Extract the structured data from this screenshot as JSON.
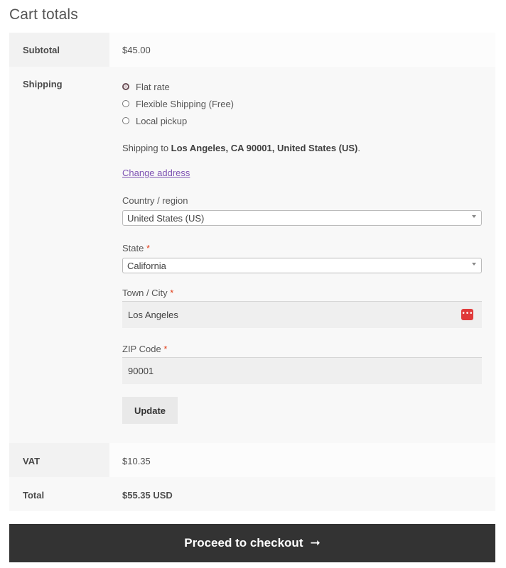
{
  "heading": "Cart totals",
  "subtotal": {
    "label": "Subtotal",
    "value": "$45.00"
  },
  "shipping": {
    "label": "Shipping",
    "methods": [
      {
        "label": "Flat rate",
        "selected": true
      },
      {
        "label": "Flexible Shipping (Free)",
        "selected": false
      },
      {
        "label": "Local pickup",
        "selected": false
      }
    ],
    "destination_prefix": "Shipping to ",
    "destination": "Los Angeles, CA 90001, United States (US)",
    "destination_suffix": ".",
    "change_address": "Change address",
    "country_label": "Country / region",
    "country_value": "United States (US)",
    "state_label": "State",
    "state_value": "California",
    "city_label": "Town / City",
    "city_value": "Los Angeles",
    "zip_label": "ZIP Code",
    "zip_value": "90001",
    "required_mark": "*",
    "update_label": "Update"
  },
  "vat": {
    "label": "VAT",
    "value": "$10.35"
  },
  "total": {
    "label": "Total",
    "value": "$55.35 USD"
  },
  "checkout": {
    "label": "Proceed to checkout",
    "arrow": "➞"
  },
  "colors": {
    "checkout_bg": "#333333",
    "link": "#7f54b3",
    "required": "#e2401c",
    "password_manager_icon": "#e03a3a"
  }
}
